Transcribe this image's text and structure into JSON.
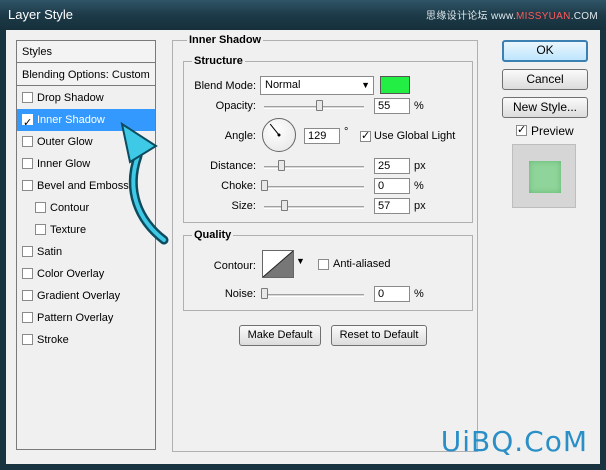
{
  "window": {
    "title": "Layer Style",
    "watermark_top": "思缘设计论坛",
    "watermark_top_site_a": "www.",
    "watermark_top_site_b": "MISSYUAN",
    "watermark_top_site_c": ".COM"
  },
  "sidebar": {
    "header": "Styles",
    "blending": "Blending Options: Custom",
    "items": [
      {
        "label": "Drop Shadow",
        "checked": false
      },
      {
        "label": "Inner Shadow",
        "checked": true,
        "selected": true
      },
      {
        "label": "Outer Glow",
        "checked": false
      },
      {
        "label": "Inner Glow",
        "checked": false
      },
      {
        "label": "Bevel and Emboss",
        "checked": false
      },
      {
        "label": "Contour",
        "checked": false,
        "sub": true
      },
      {
        "label": "Texture",
        "checked": false,
        "sub": true
      },
      {
        "label": "Satin",
        "checked": false
      },
      {
        "label": "Color Overlay",
        "checked": false
      },
      {
        "label": "Gradient Overlay",
        "checked": false
      },
      {
        "label": "Pattern Overlay",
        "checked": false
      },
      {
        "label": "Stroke",
        "checked": false
      }
    ]
  },
  "inner_shadow": {
    "title": "Inner Shadow",
    "structure": {
      "title": "Structure",
      "blend_mode_label": "Blend Mode:",
      "blend_mode_value": "Normal",
      "color": "#22ee44",
      "opacity_label": "Opacity:",
      "opacity_value": "55",
      "opacity_unit": "%",
      "opacity_fraction": 0.55,
      "angle_label": "Angle:",
      "angle_value": "129",
      "angle_unit": "°",
      "angle_degrees": 129,
      "global_light_label": "Use Global Light",
      "global_light_checked": true,
      "distance_label": "Distance:",
      "distance_value": "25",
      "distance_unit": "px",
      "distance_fraction": 0.17,
      "choke_label": "Choke:",
      "choke_value": "0",
      "choke_unit": "%",
      "choke_fraction": 0.0,
      "size_label": "Size:",
      "size_value": "57",
      "size_unit": "px",
      "size_fraction": 0.2
    },
    "quality": {
      "title": "Quality",
      "contour_label": "Contour:",
      "anti_aliased_label": "Anti-aliased",
      "anti_aliased_checked": false,
      "noise_label": "Noise:",
      "noise_value": "0",
      "noise_unit": "%",
      "noise_fraction": 0.0
    },
    "make_default_label": "Make Default",
    "reset_default_label": "Reset to Default"
  },
  "actions": {
    "ok_label": "OK",
    "cancel_label": "Cancel",
    "new_style_label": "New Style...",
    "preview_label": "Preview",
    "preview_checked": true
  },
  "watermark": "UiBQ.CoM",
  "colors": {
    "accent": "#3399ff",
    "shadow_color": "#22ee44",
    "preview_fill": "#8fd49a"
  }
}
